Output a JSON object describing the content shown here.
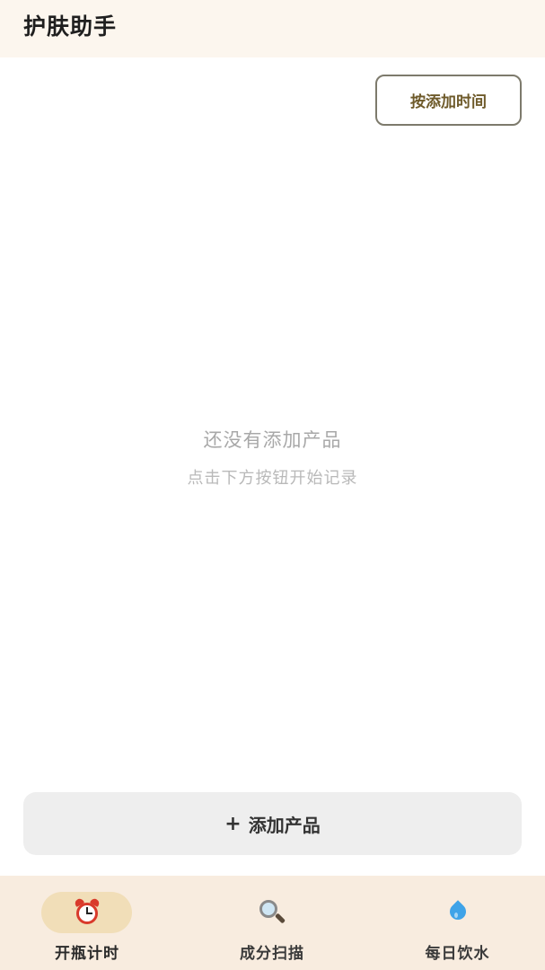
{
  "app": {
    "title": "护肤助手"
  },
  "toolbar": {
    "sort_label": "按添加时间"
  },
  "empty_state": {
    "title": "还没有添加产品",
    "subtitle": "点击下方按钮开始记录"
  },
  "add_button": {
    "plus": "+",
    "label": "添加产品"
  },
  "bottom_nav": {
    "items": [
      {
        "label": "开瓶计时",
        "icon": "alarm-clock-icon",
        "active": true
      },
      {
        "label": "成分扫描",
        "icon": "magnifier-icon",
        "active": false
      },
      {
        "label": "每日饮水",
        "icon": "water-drop-icon",
        "active": false
      }
    ]
  },
  "colors": {
    "header_bg": "#fcf6ee",
    "nav_bg": "#f8ecdf",
    "active_pill": "#f1deb8",
    "sort_border": "#7d7a6c",
    "add_button_bg": "#eeeeee"
  }
}
